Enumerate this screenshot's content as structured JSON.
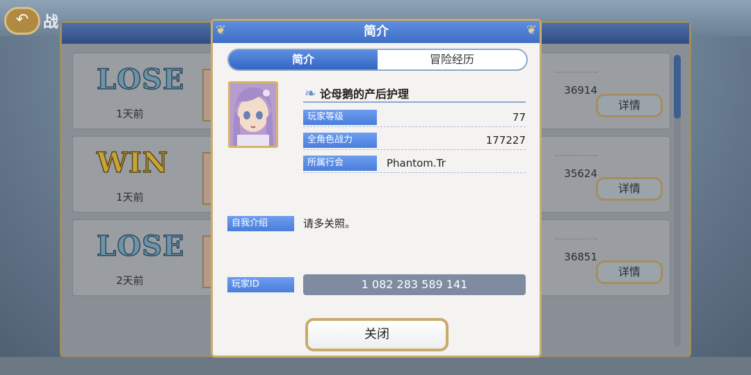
{
  "background": {
    "title_fragment": "战",
    "rows": [
      {
        "result": "LOSE",
        "result_type": "lose",
        "time": "1天前",
        "power": "36914",
        "detail_label": "详情"
      },
      {
        "result": "WIN",
        "result_type": "win",
        "time": "1天前",
        "power": "35624",
        "detail_label": "详情"
      },
      {
        "result": "LOSE",
        "result_type": "lose",
        "time": "2天前",
        "power": "36851",
        "detail_label": "详情"
      }
    ]
  },
  "modal": {
    "title": "简介",
    "tabs": [
      {
        "label": "简介",
        "active": true
      },
      {
        "label": "冒险经历",
        "active": false
      }
    ],
    "player": {
      "name": "论母鹅的产后护理",
      "level_label": "玩家等级",
      "level_value": "77",
      "power_label": "全角色战力",
      "power_value": "177227",
      "guild_label": "所属行会",
      "guild_value": "Phantom.Tr"
    },
    "intro_label": "自我介绍",
    "intro_text": "请多关照。",
    "id_label": "玩家ID",
    "id_value": "1 082 283 589 141",
    "close_label": "关闭"
  },
  "colors": {
    "accent_blue": "#4a7edb",
    "gold_border": "#c9ab69"
  },
  "icons": {
    "back": "back-arrow-icon",
    "feather": "feather-icon"
  }
}
